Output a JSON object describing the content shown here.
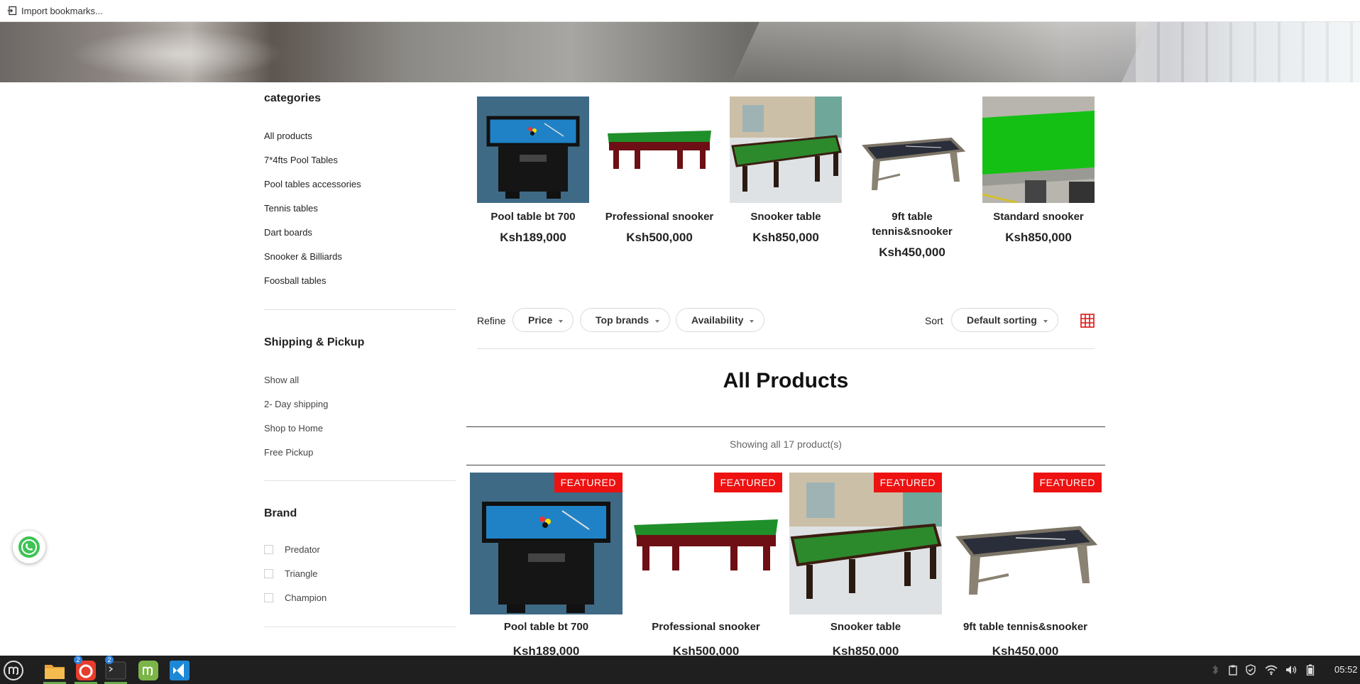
{
  "bookmarks": {
    "import_label": "Import bookmarks..."
  },
  "sidebar": {
    "categories_title": "categories",
    "categories": [
      "All products",
      "7*4fts Pool Tables",
      "Pool tables accessories",
      "Tennis tables",
      "Dart boards",
      "Snooker & Billiards",
      "Foosball tables"
    ],
    "shipping_title": "Shipping & Pickup",
    "shipping": [
      "Show all",
      "2- Day shipping",
      "Shop to Home",
      "Free Pickup"
    ],
    "brand_title": "Brand",
    "brands": [
      "Predator",
      "Triangle",
      "Champion"
    ]
  },
  "featured_strip": [
    {
      "name": "Pool table bt 700",
      "price": "Ksh189,000",
      "image": "pool-table-blue-image"
    },
    {
      "name": "Professional snooker",
      "price": "Ksh500,000",
      "image": "snooker-green-wood-image"
    },
    {
      "name": "Snooker table",
      "price": "Ksh850,000",
      "image": "snooker-room-image"
    },
    {
      "name": "9ft table tennis&snooker",
      "price": "Ksh450,000",
      "image": "black-pool-table-image"
    },
    {
      "name": "Standard snooker",
      "price": "Ksh850,000",
      "image": "standard-snooker-image"
    }
  ],
  "toolbar": {
    "refine_label": "Refine",
    "filters": [
      "Price",
      "Top brands",
      "Availability"
    ],
    "sort_label": "Sort",
    "sort_value": "Default sorting",
    "grid_view_icon": "grid-view-icon"
  },
  "products_section": {
    "title": "All Products",
    "showing": "Showing all 17 product(s)",
    "badge": "FEATURED",
    "items": [
      {
        "name": "Pool table bt 700",
        "price": "Ksh189,000"
      },
      {
        "name": "Professional snooker",
        "price": "Ksh500,000"
      },
      {
        "name": "Snooker table",
        "price": "Ksh850,000"
      },
      {
        "name": "9ft table tennis&snooker",
        "price": "Ksh450,000"
      }
    ]
  },
  "taskbar": {
    "apps": [
      "mint-menu-icon",
      "files-icon",
      "firefox-icon",
      "terminal-icon",
      "mint-update-icon",
      "vscode-icon"
    ],
    "counts": [
      "2",
      "2"
    ],
    "time": "05:52"
  },
  "colors": {
    "accent_red": "#ee1111",
    "taskbar": "#1f1f1f"
  }
}
